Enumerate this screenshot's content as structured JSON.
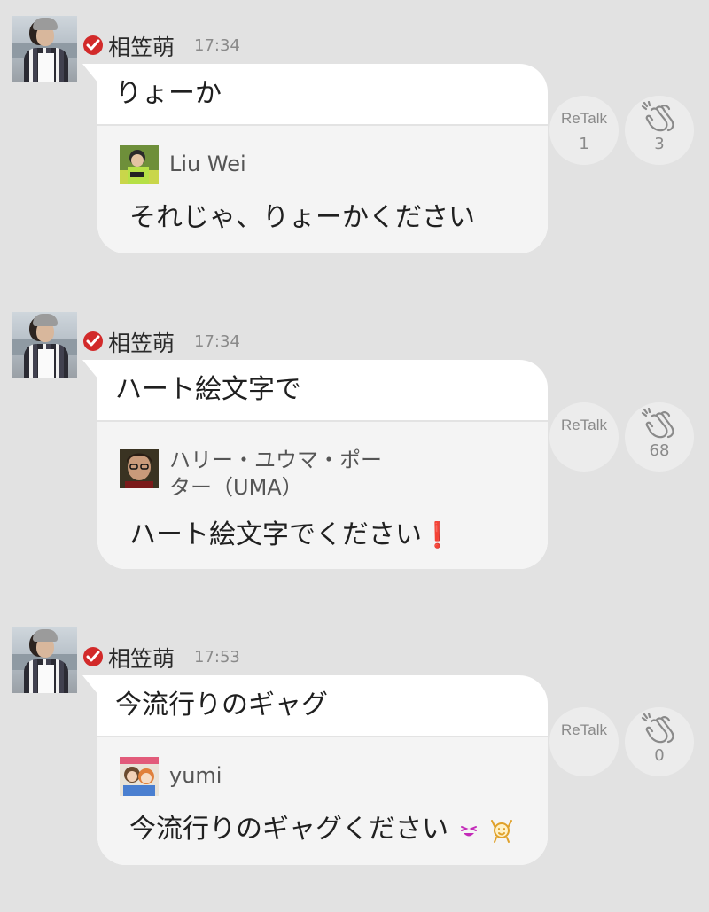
{
  "posts": [
    {
      "author": "相笠萌",
      "time": "17:34",
      "message": "りょーか",
      "quote": {
        "name": "Liu Wei",
        "text": "それじゃ、りょーかください"
      },
      "retalk_label": "ReTalk",
      "retalk_count": "1",
      "clap_count": "3"
    },
    {
      "author": "相笠萌",
      "time": "17:34",
      "message": "ハート絵文字で",
      "quote": {
        "name_line1": "ハリー・ユウマ・ポー",
        "name_line2": "ター（UMA）",
        "text": "ハート絵文字でください",
        "emoji": "❗"
      },
      "retalk_label": "ReTalk",
      "retalk_count": "",
      "clap_count": "68"
    },
    {
      "author": "相笠萌",
      "time": "17:53",
      "message": "今流行りのギャグ",
      "quote": {
        "name": "yumi",
        "text": "今流行りのギャグください"
      },
      "retalk_label": "ReTalk",
      "retalk_count": "",
      "clap_count": "0"
    }
  ],
  "colors": {
    "background": "#e2e2e2",
    "verified": "#d22a2a",
    "bubble": "#ffffff",
    "quote_bg": "#f4f4f4",
    "action_circle": "#ececec"
  },
  "icons": {
    "verified": "check-circle-icon",
    "clap": "clapping-hands-icon",
    "emoji_bang": "exclamation-icon",
    "emoji_face": "grinning-face-icon",
    "emoji_cheer": "cheering-figure-icon"
  }
}
